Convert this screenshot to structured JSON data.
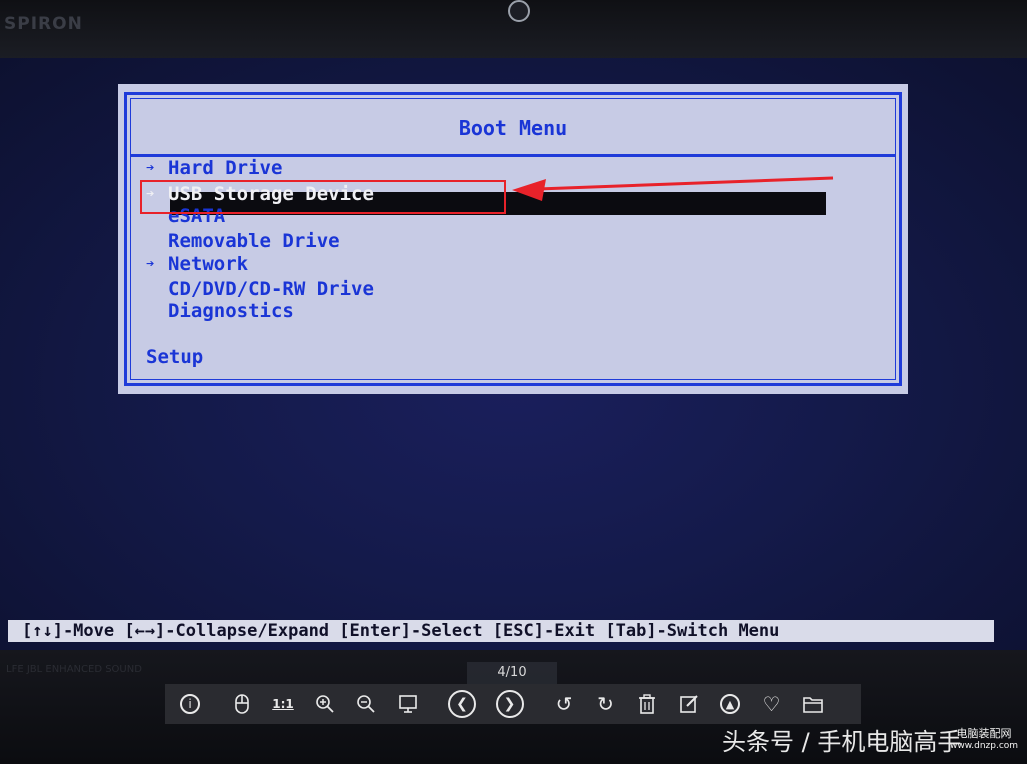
{
  "bezel": {
    "brand": "SPIRON",
    "bottom_label": "LFE JBL ENHANCED SOUND"
  },
  "boot_menu": {
    "title": "Boot Menu",
    "items": [
      {
        "label": "Hard Drive",
        "expandable": true,
        "selected": false
      },
      {
        "label": "USB Storage Device",
        "expandable": true,
        "selected": true
      },
      {
        "label": "eSATA",
        "expandable": false,
        "selected": false
      },
      {
        "label": "Removable Drive",
        "expandable": false,
        "selected": false
      },
      {
        "label": "Network",
        "expandable": true,
        "selected": false
      },
      {
        "label": "CD/DVD/CD-RW Drive",
        "expandable": false,
        "selected": false
      },
      {
        "label": "Diagnostics",
        "expandable": false,
        "selected": false
      }
    ],
    "setup_label": "Setup",
    "colors": {
      "text": "#1a35d6",
      "frame": "#1f3bd9",
      "background": "#c7cbe5",
      "selection": "#0b0b10",
      "annotation": "#e8222a"
    }
  },
  "help_bar": {
    "text": "[↑↓]-Move [←→]-Collapse/Expand [Enter]-Select [ESC]-Exit [Tab]-Switch Menu"
  },
  "viewer": {
    "page_counter": "4/10",
    "toolbar": [
      {
        "name": "info-icon",
        "glyph": "ⓘ"
      },
      {
        "name": "mouse-icon",
        "glyph": "⊕"
      },
      {
        "name": "actual-size-icon",
        "glyph": "1:1"
      },
      {
        "name": "zoom-in-icon",
        "glyph": "⊕"
      },
      {
        "name": "zoom-out-icon",
        "glyph": "⊖"
      },
      {
        "name": "fit-screen-icon",
        "glyph": "⧉"
      },
      {
        "name": "prev-icon",
        "glyph": "‹"
      },
      {
        "name": "next-icon",
        "glyph": "›"
      },
      {
        "name": "rotate-left-icon",
        "glyph": "↺"
      },
      {
        "name": "rotate-right-icon",
        "glyph": "↻"
      },
      {
        "name": "delete-icon",
        "glyph": "🗑"
      },
      {
        "name": "edit-icon",
        "glyph": "✎"
      },
      {
        "name": "collapse-up-icon",
        "glyph": "⌃"
      },
      {
        "name": "favorite-icon",
        "glyph": "♡"
      },
      {
        "name": "folder-icon",
        "glyph": "🗀"
      }
    ]
  },
  "watermark": {
    "text": "头条号 / 手机电脑高手",
    "site_line1": "电脑装配网",
    "site_line2": "www.dnzp.com"
  }
}
